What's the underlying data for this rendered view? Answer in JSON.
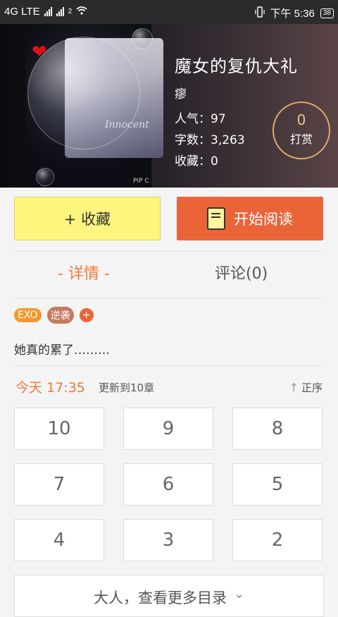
{
  "status_bar": {
    "network": "4G LTE",
    "sim2": "2",
    "time": "下午 5:36",
    "battery": "38"
  },
  "book": {
    "title": "魔女的复仇大礼",
    "author": "瘳",
    "stats": [
      {
        "label": "人气：",
        "value": "97"
      },
      {
        "label": "字数：",
        "value": "3,263"
      },
      {
        "label": "收藏：",
        "value": "0"
      }
    ],
    "tip": {
      "count": "0",
      "label": "打赏"
    },
    "cover": {
      "watermark": "PIP C",
      "caption": "Innocent"
    }
  },
  "actions": {
    "favorite": "+ 收藏",
    "read": "开始阅读"
  },
  "tabs": {
    "detail": "- 详情 -",
    "comments": "评论(0)"
  },
  "tags": [
    "EXO",
    "逆袭",
    "+"
  ],
  "summary": "她真的累了………",
  "update": {
    "day": "今天",
    "time": "17:35",
    "text": "更新到10章"
  },
  "sort": {
    "label": "正序"
  },
  "chapters": [
    "10",
    "9",
    "8",
    "7",
    "6",
    "5",
    "4",
    "3",
    "2"
  ],
  "more_link": "大人，查看更多目录",
  "colors": {
    "accent": "#ea6438",
    "favorite_bg": "#fdf57e",
    "tag_exo": "#f09a2c",
    "tag_ni": "#c77a5b"
  }
}
